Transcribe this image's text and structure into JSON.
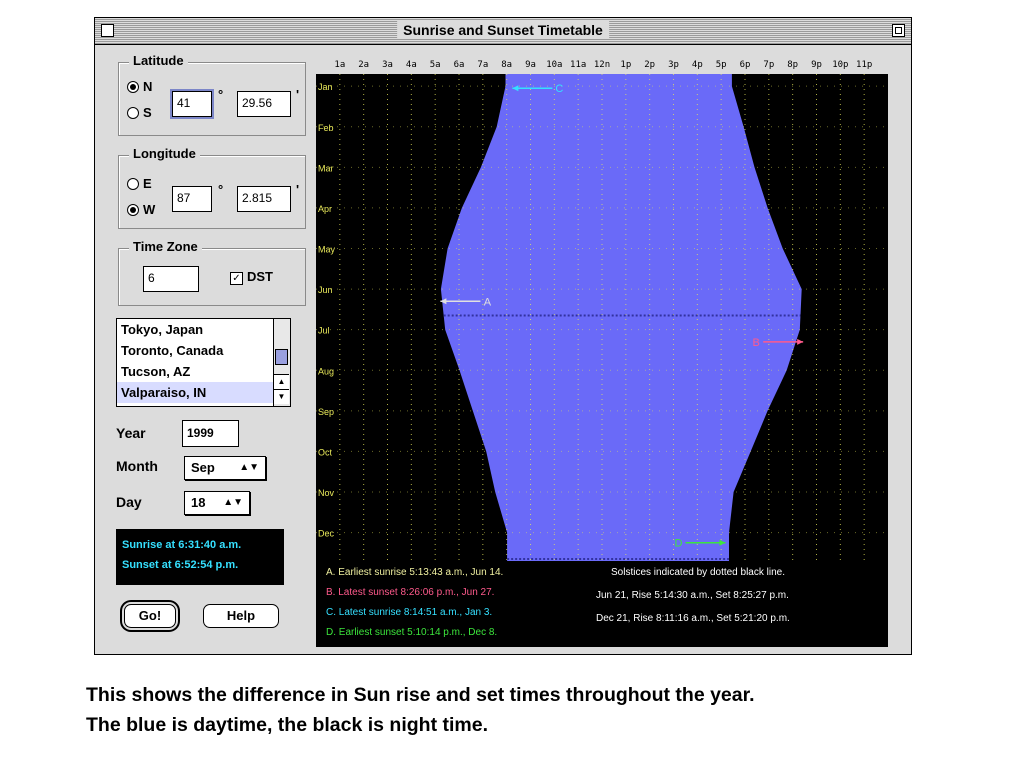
{
  "window": {
    "title": "Sunrise and Sunset Timetable"
  },
  "latitude": {
    "label": "Latitude",
    "options": [
      "N",
      "S"
    ],
    "selected": "N",
    "degrees": "41",
    "degree_symbol": "°",
    "minutes": "29.56",
    "minute_symbol": "'"
  },
  "longitude": {
    "label": "Longitude",
    "options": [
      "E",
      "W"
    ],
    "selected": "W",
    "degrees": "87",
    "degree_symbol": "°",
    "minutes": "2.815",
    "minute_symbol": "'"
  },
  "timezone": {
    "label": "Time Zone",
    "value": "6",
    "dst_label": "DST",
    "dst_checked": true
  },
  "cities": {
    "items": [
      "Tokyo, Japan",
      "Toronto, Canada",
      "Tucson, AZ",
      "Valparaiso, IN"
    ],
    "selected_index": 3
  },
  "form": {
    "year_label": "Year",
    "year_value": "1999",
    "month_label": "Month",
    "month_value": "Sep",
    "day_label": "Day",
    "day_value": "18"
  },
  "result": {
    "sunrise": "Sunrise at 6:31:40 a.m.",
    "sunset": "Sunset at 6:52:54 p.m."
  },
  "buttons": {
    "go": "Go!",
    "help": "Help"
  },
  "chart_data": {
    "type": "area",
    "x_tick_labels": [
      "1a",
      "2a",
      "3a",
      "4a",
      "5a",
      "6a",
      "7a",
      "8a",
      "9a",
      "10a",
      "11a",
      "12n",
      "1p",
      "2p",
      "3p",
      "4p",
      "5p",
      "6p",
      "7p",
      "8p",
      "9p",
      "10p",
      "11p"
    ],
    "x_range_hours": [
      0,
      24
    ],
    "y_labels": [
      "Jan",
      "Feb",
      "Mar",
      "Apr",
      "May",
      "Jun",
      "Jul",
      "Aug",
      "Sep",
      "Oct",
      "Nov",
      "Dec"
    ],
    "grid": true,
    "sunrise_hours": [
      7.95,
      7.58,
      6.92,
      6.12,
      5.52,
      5.24,
      5.42,
      6.02,
      6.58,
      7.14,
      7.52,
      8.02
    ],
    "sunset_hours": [
      17.45,
      17.94,
      18.4,
      18.95,
      19.58,
      20.38,
      20.3,
      19.75,
      18.95,
      18.24,
      17.52,
      17.33
    ],
    "colors": {
      "day": "#6a6af8",
      "night": "#000000",
      "grid": "#e8e85a",
      "axis_text": "#e8e85a",
      "solstice_line": "#3232a0"
    },
    "markers": [
      {
        "id": "A",
        "hour": 5.22,
        "month": 5.3,
        "color": "#e0e0e0"
      },
      {
        "id": "B",
        "hour": 20.44,
        "month": 6.3,
        "color": "#ff5a8c"
      },
      {
        "id": "C",
        "hour": 8.24,
        "month": 0.05,
        "color": "#35e0ff"
      },
      {
        "id": "D",
        "hour": 17.18,
        "month": 11.25,
        "color": "#3ce63c"
      }
    ],
    "solstices": [
      {
        "month": 5.65
      },
      {
        "month": 11.65
      }
    ]
  },
  "legend": {
    "items": [
      {
        "text": "A.  Earliest sunrise  5:13:43 a.m., Jun 14.",
        "color": "#f0f0a0"
      },
      {
        "text": "B.  Latest sunset  8:26:06 p.m., Jun 27.",
        "color": "#ff5a8c"
      },
      {
        "text": "C.  Latest sunrise  8:14:51 a.m., Jan 3.",
        "color": "#35e0ff"
      },
      {
        "text": "D.  Earliest sunset  5:10:14 p.m., Dec 8.",
        "color": "#3ce63c"
      }
    ],
    "solstice_note": "Solstices indicated by dotted black line.",
    "jun": "Jun 21,  Rise  5:14:30 a.m.,  Set  8:25:27 p.m.",
    "dec": "Dec 21,  Rise  8:11:16 a.m.,  Set  5:21:20 p.m."
  },
  "caption": {
    "line1": "This shows the difference in Sun rise and set times throughout the year.",
    "line2": "The blue is daytime, the black is night time."
  }
}
